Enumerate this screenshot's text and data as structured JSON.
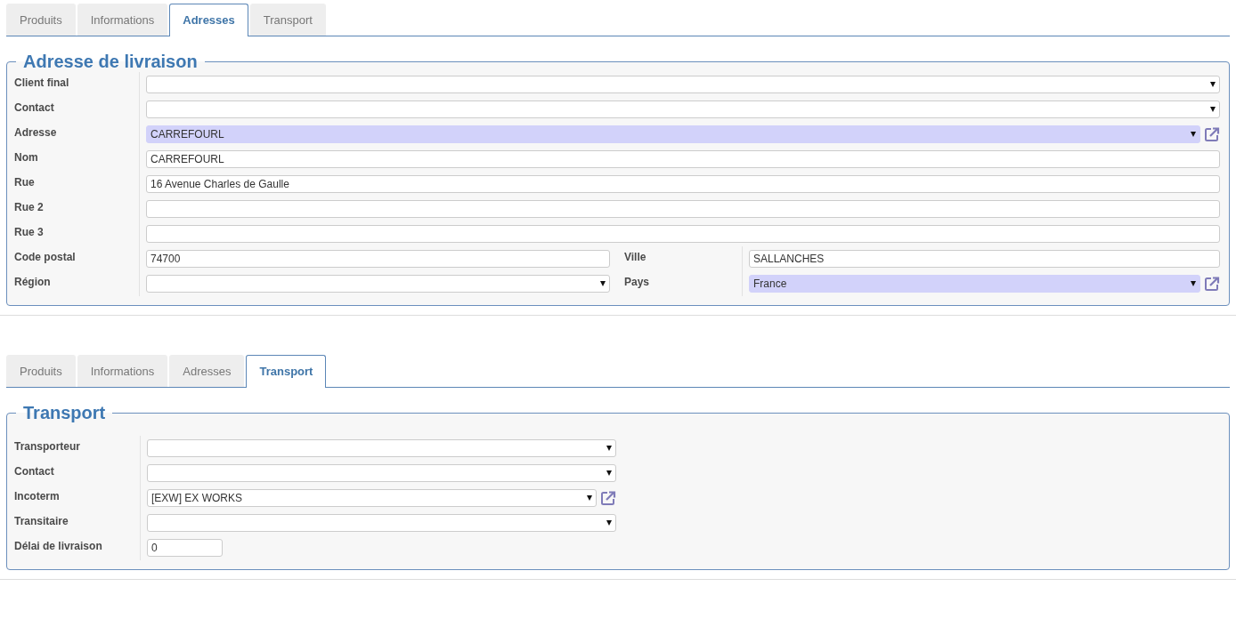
{
  "sections": [
    {
      "tabs": [
        {
          "label": "Produits",
          "selected": false
        },
        {
          "label": "Informations",
          "selected": false
        },
        {
          "label": "Adresses",
          "selected": true
        },
        {
          "label": "Transport",
          "selected": false
        }
      ],
      "title": "Adresse de livraison",
      "rows": [
        {
          "fields": [
            {
              "label": "Client final",
              "kind": "select",
              "required": false,
              "link": false
            }
          ]
        },
        {
          "fields": [
            {
              "label": "Contact",
              "kind": "select",
              "required": false,
              "link": false
            }
          ]
        },
        {
          "fields": [
            {
              "label": "Adresse",
              "kind": "select",
              "value": "CARREFOURL",
              "required": true,
              "link": true
            }
          ]
        },
        {
          "fields": [
            {
              "label": "Nom",
              "kind": "text",
              "value": "CARREFOURL",
              "required": false,
              "link": false
            }
          ]
        },
        {
          "fields": [
            {
              "label": "Rue",
              "kind": "text",
              "value": "16 Avenue Charles de Gaulle",
              "required": false,
              "link": false
            }
          ]
        },
        {
          "fields": [
            {
              "label": "Rue 2",
              "kind": "text",
              "required": false,
              "link": false
            }
          ]
        },
        {
          "fields": [
            {
              "label": "Rue 3",
              "kind": "text",
              "required": false,
              "link": false
            }
          ]
        },
        {
          "fields": [
            {
              "label": "Code postal",
              "kind": "text",
              "value": "74700",
              "required": false,
              "link": false
            },
            {
              "label": "Ville",
              "kind": "text",
              "value": "SALLANCHES",
              "required": false,
              "link": false
            }
          ]
        },
        {
          "fields": [
            {
              "label": "Région",
              "kind": "select",
              "required": false,
              "link": false
            },
            {
              "label": "Pays",
              "kind": "select",
              "value": "France",
              "required": true,
              "link": true
            }
          ]
        }
      ]
    },
    {
      "tabs": [
        {
          "label": "Produits",
          "selected": false
        },
        {
          "label": "Informations",
          "selected": false
        },
        {
          "label": "Adresses",
          "selected": false
        },
        {
          "label": "Transport",
          "selected": true
        }
      ],
      "title": "Transport",
      "rows": [
        {
          "fields": [
            {
              "label": "Transporteur",
              "kind": "select",
              "required": false,
              "link": false
            }
          ]
        },
        {
          "fields": [
            {
              "label": "Contact",
              "kind": "select",
              "required": false,
              "link": false
            }
          ]
        },
        {
          "fields": [
            {
              "label": "Incoterm",
              "kind": "select",
              "value": "[EXW] EX WORKS",
              "required": false,
              "link": true
            }
          ]
        },
        {
          "fields": [
            {
              "label": "Transitaire",
              "kind": "select",
              "required": false,
              "link": false
            }
          ]
        },
        {
          "fields": [
            {
              "label": "Délai de livraison",
              "kind": "number",
              "value": "0",
              "required": false,
              "link": false
            }
          ]
        }
      ]
    }
  ]
}
